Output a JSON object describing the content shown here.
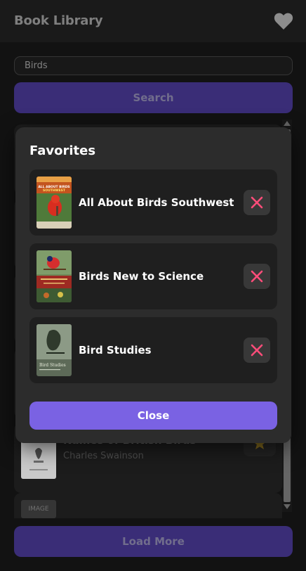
{
  "header": {
    "title": "Book Library",
    "favorites_icon": "heart-icon"
  },
  "search": {
    "value": "Birds",
    "button_label": "Search"
  },
  "results": [
    {
      "title": "Names of British Birds",
      "author": "Charles Swainson",
      "favorite": true
    },
    {
      "image_placeholder": "IMAGE"
    }
  ],
  "load_more_label": "Load More",
  "modal": {
    "title": "Favorites",
    "items": [
      {
        "title": "All About Birds Southwest",
        "cover_text": "ALL ABOUT BIRDS SOUTHWEST"
      },
      {
        "title": "Birds New to Science"
      },
      {
        "title": "Bird Studies",
        "cover_text": "Bird Studies"
      }
    ],
    "remove_icon": "close-icon",
    "close_label": "Close"
  },
  "colors": {
    "accent": "#7a62e3",
    "accent_dim": "#3f3182",
    "remove": "#ff4d7a",
    "star": "#c9a227",
    "background": "#141414",
    "panel": "#2c2c2c"
  }
}
